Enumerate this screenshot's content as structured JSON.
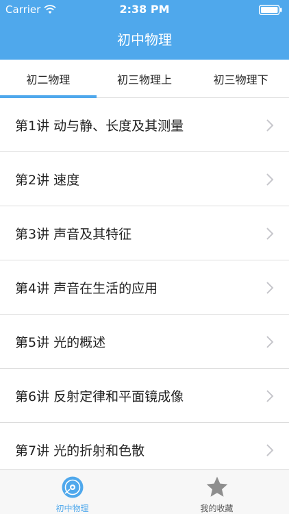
{
  "status_bar": {
    "carrier": "Carrier",
    "time": "2:38 PM"
  },
  "nav": {
    "title": "初中物理"
  },
  "tabs": [
    {
      "label": "初二物理",
      "selected": true
    },
    {
      "label": "初三物理上",
      "selected": false
    },
    {
      "label": "初三物理下",
      "selected": false
    }
  ],
  "lessons": [
    {
      "label": "第1讲 动与静、长度及其测量"
    },
    {
      "label": "第2讲 速度"
    },
    {
      "label": "第3讲 声音及其特征"
    },
    {
      "label": "第4讲 声音在生活的应用"
    },
    {
      "label": "第5讲 光的概述"
    },
    {
      "label": "第6讲 反射定律和平面镜成像"
    },
    {
      "label": "第7讲 光的折射和色散"
    }
  ],
  "tabbar": {
    "items": [
      {
        "label": "初中物理",
        "icon": "disc-icon",
        "active": true
      },
      {
        "label": "我的收藏",
        "icon": "star-icon",
        "active": false
      }
    ]
  },
  "colors": {
    "accent": "#4fa8ec",
    "inactive_icon": "#8e8e8e",
    "text": "#222222"
  }
}
